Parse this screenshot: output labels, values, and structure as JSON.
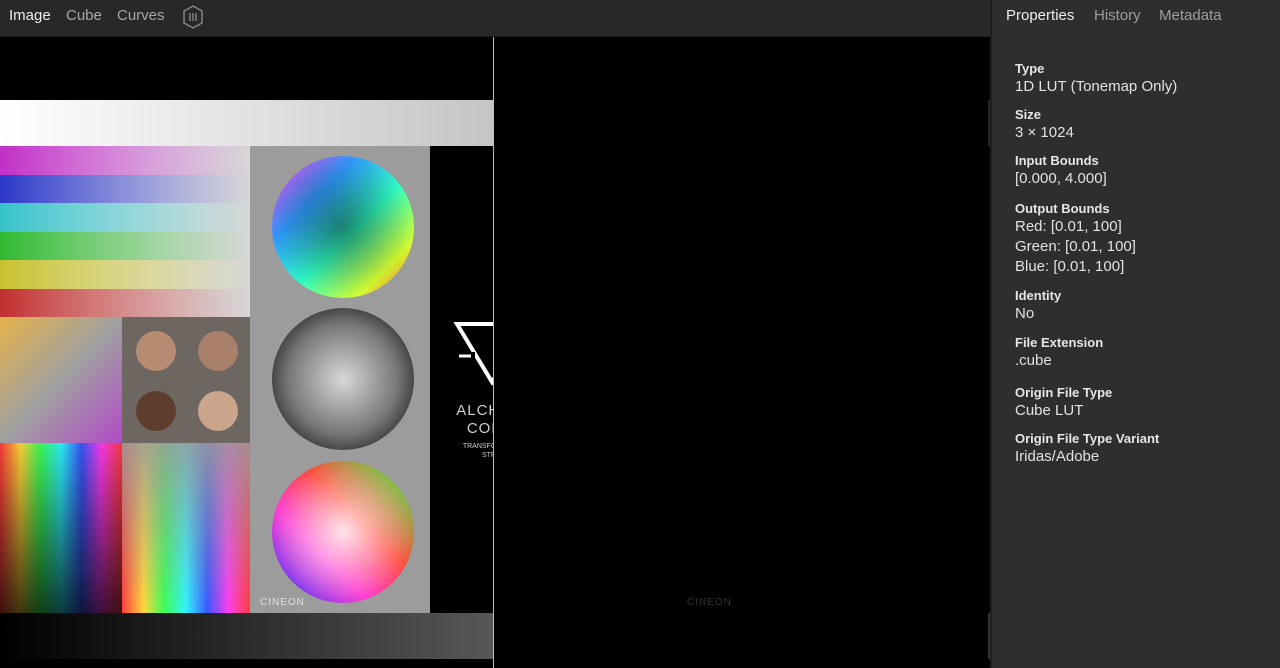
{
  "toolbar": {
    "tabs": [
      "Image",
      "Cube",
      "Curves"
    ],
    "active_tab": "Image",
    "split_view_icon": "split-view-icon"
  },
  "viewer": {
    "left_label": "CINEON",
    "right_label": "CINEON",
    "logo_line1": "ALCHEMY",
    "logo_line2": "COLOR",
    "logo_tagline1": "TRANSFORM YOUR",
    "logo_tagline2": "STRESS"
  },
  "panel": {
    "tabs": [
      "Properties",
      "History",
      "Metadata"
    ],
    "active_tab": "Properties",
    "properties": {
      "type_label": "Type",
      "type_value": "1D LUT (Tonemap Only)",
      "size_label": "Size",
      "size_value": "3 × 1024",
      "input_bounds_label": "Input Bounds",
      "input_bounds_value": "[0.000, 4.000]",
      "output_bounds_label": "Output Bounds",
      "output_red": "Red: [0.01, 100]",
      "output_green": "Green: [0.01, 100]",
      "output_blue": "Blue: [0.01, 100]",
      "identity_label": "Identity",
      "identity_value": "No",
      "file_extension_label": "File Extension",
      "file_extension_value": ".cube",
      "origin_type_label": "Origin File Type",
      "origin_type_value": "Cube LUT",
      "origin_variant_label": "Origin File Type Variant",
      "origin_variant_value": "Iridas/Adobe"
    }
  }
}
